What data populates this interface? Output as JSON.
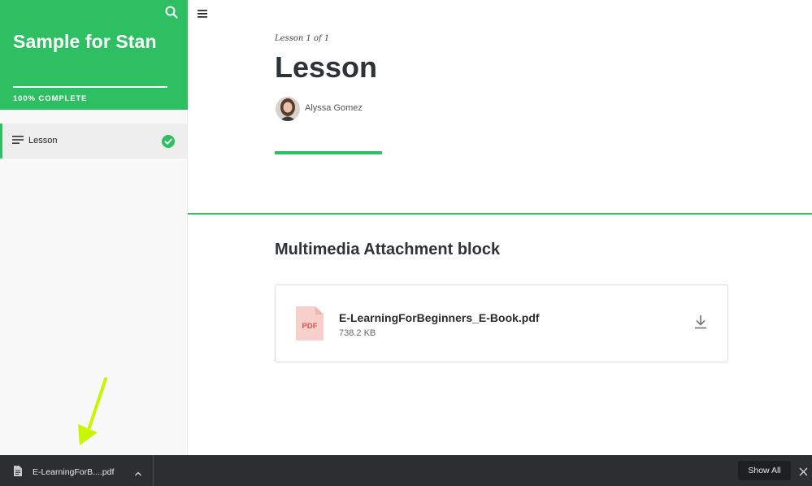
{
  "sidebar": {
    "course_title": "Sample for Stan",
    "progress_label": "100% COMPLETE",
    "progress_fraction": 1.0,
    "items": [
      {
        "label": "Lesson",
        "completed": true
      }
    ],
    "icons": {
      "search": "search-icon",
      "lesson": "lines-icon",
      "check": "check-circle-icon"
    }
  },
  "main": {
    "lesson_counter": "Lesson 1 of 1",
    "lesson_title": "Lesson",
    "author": {
      "name": "Alyssa Gomez"
    },
    "block": {
      "title": "Multimedia Attachment block",
      "attachment": {
        "file_name": "E-LearningForBeginners_E-Book.pdf",
        "file_size": "738.2 KB",
        "file_type_label": "PDF"
      }
    }
  },
  "download_bar": {
    "file_name": "E-LearningForB....pdf",
    "show_all_label": "Show All"
  },
  "colors": {
    "accent": "#2fbf63",
    "pdf_icon": "#f7d0cc",
    "pdf_label": "#d9534f",
    "download_bar": "#2d2e30",
    "annotation_arrow": "#c8f500"
  }
}
